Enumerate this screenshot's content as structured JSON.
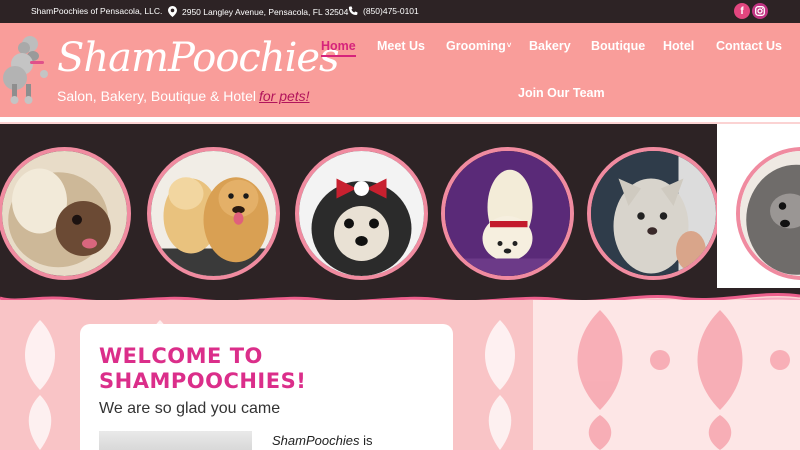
{
  "topbar": {
    "business_name": "ShamPoochies of Pensacola, LLC.",
    "address": "2950 Langley Avenue, Pensacola, FL 32504",
    "phone": "(850)475-0101",
    "social": [
      {
        "name": "facebook",
        "glyph": "f",
        "icon": "facebook-icon"
      },
      {
        "name": "instagram",
        "glyph": "◎",
        "icon": "instagram-icon"
      }
    ]
  },
  "header": {
    "logo_title": "ShamPoochies",
    "logo_subtitle": "Salon, Bakery, Boutique & Hotel",
    "logo_subtitle_em": "for pets!"
  },
  "nav": {
    "items": [
      "Home",
      "Meet Us",
      "Grooming",
      "Bakery",
      "Boutique",
      "Hotel",
      "Contact Us",
      "Join Our Team"
    ],
    "active": "Home",
    "grooming_caret": "˅"
  },
  "slider": {
    "photos": [
      "shih-tzu-photo",
      "golden-retrievers-photo",
      "yorkie-puppy-photo",
      "puppy-on-back-photo",
      "wet-terrier-photo",
      "gray-shih-tzu-photo"
    ]
  },
  "welcome": {
    "heading_line1": "WELCOME TO",
    "heading_line2": "SHAMPOOCHIES!",
    "subheading": "We are so glad you came",
    "body_em": "ShamPoochies",
    "body_rest": " is"
  },
  "colors": {
    "header_bg": "#f99d9a",
    "dark_bar": "#2d2325",
    "accent_pink": "#d6247b",
    "photo_border": "#f08ba0",
    "damask_bg": "#fbd3d3"
  }
}
